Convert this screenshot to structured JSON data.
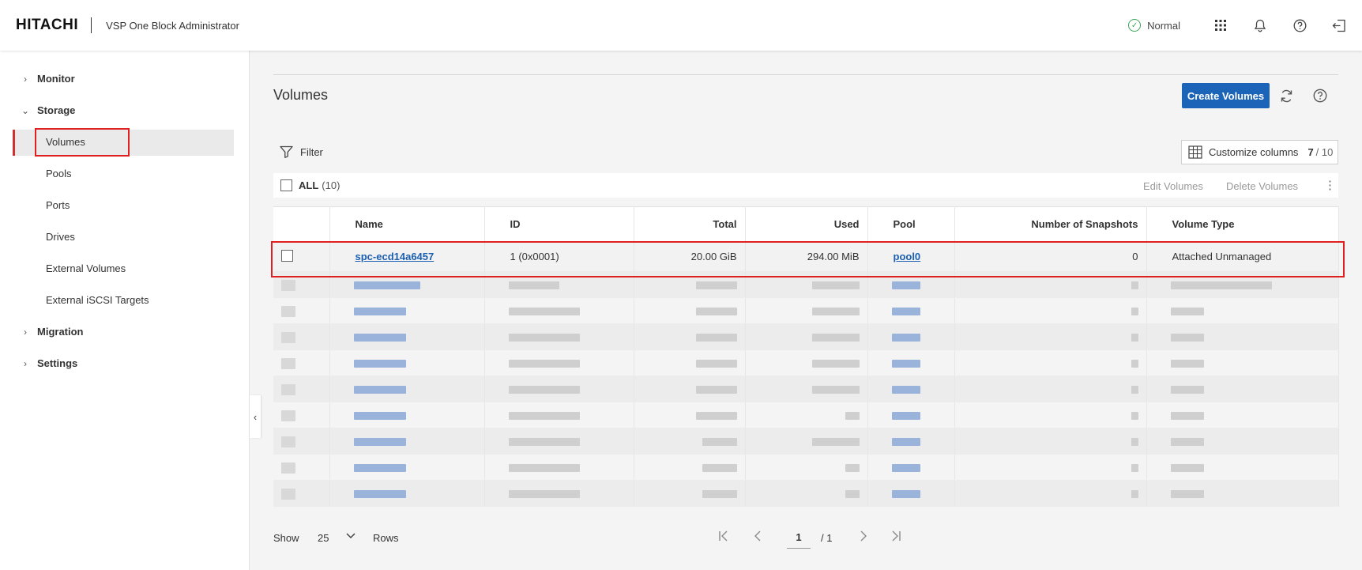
{
  "header": {
    "logo": "HITACHI",
    "product": "VSP One Block Administrator",
    "status": "Normal"
  },
  "sidebar": {
    "groups": [
      {
        "label": "Monitor",
        "expanded": false
      },
      {
        "label": "Storage",
        "expanded": true
      },
      {
        "label": "Migration",
        "expanded": false
      },
      {
        "label": "Settings",
        "expanded": false
      }
    ],
    "storage_items": [
      "Volumes",
      "Pools",
      "Ports",
      "Drives",
      "External Volumes",
      "External iSCSI Targets"
    ],
    "selected": "Volumes"
  },
  "page": {
    "title": "Volumes",
    "create_button": "Create Volumes",
    "filter_label": "Filter",
    "customize_label": "Customize columns",
    "customize_count": "7",
    "customize_total": "/ 10",
    "all_label": "ALL",
    "all_count": "(10)",
    "edit_label": "Edit Volumes",
    "delete_label": "Delete Volumes"
  },
  "table": {
    "columns": [
      "Name",
      "ID",
      "Total",
      "Used",
      "Pool",
      "Number of Snapshots",
      "Volume Type"
    ],
    "rows": [
      {
        "name": "spc-ecd14a6457",
        "id": "1 (0x0001)",
        "total": "20.00 GiB",
        "used": "294.00 MiB",
        "pool": "pool0",
        "snapshots": "0",
        "type": "Attached Unmanaged"
      }
    ]
  },
  "footer": {
    "show_label": "Show",
    "rows_value": "25",
    "rows_label": "Rows",
    "page": "1",
    "page_total": "/ 1"
  },
  "colors": {
    "accent": "#1c64b8",
    "highlight": "#e02020",
    "status_ok": "#3aa655"
  }
}
